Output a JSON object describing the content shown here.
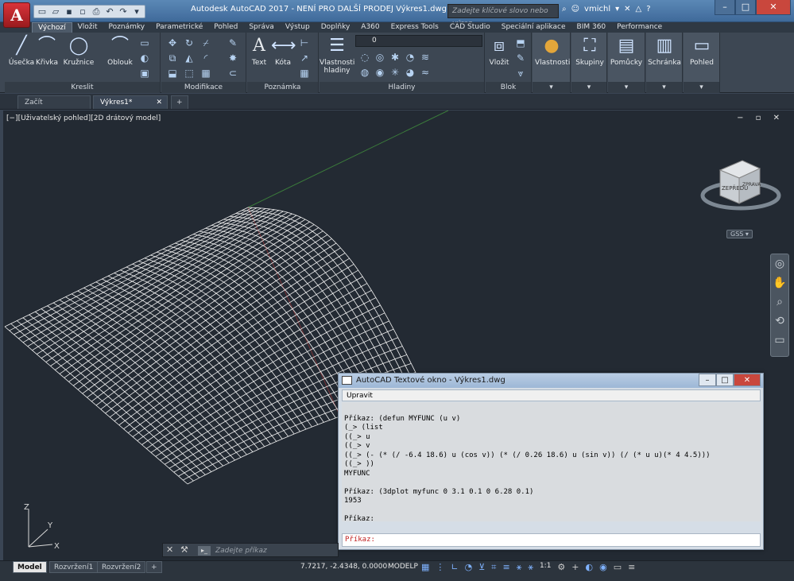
{
  "titlebar": {
    "app_letter": "A",
    "title": "Autodesk AutoCAD 2017 - NENÍ PRO DALŠÍ PRODEJ    Výkres1.dwg",
    "search_placeholder": "Zadejte klíčové slovo nebo výraz.",
    "user": "vmichl",
    "min": "–",
    "max": "□",
    "close": "✕"
  },
  "ribbon": {
    "tabs": [
      "Výchozí",
      "Vložit",
      "Poznámky",
      "Parametrické",
      "Pohled",
      "Správa",
      "Výstup",
      "Doplňky",
      "A360",
      "Express Tools",
      "CAD Studio",
      "Speciální aplikace",
      "BIM 360",
      "Performance"
    ],
    "draw": {
      "tools": [
        "Úsečka",
        "Křivka",
        "Kružnice",
        "Oblouk"
      ],
      "footer": "Kreslit"
    },
    "modify": {
      "footer": "Modifikace"
    },
    "annotation": {
      "tools": [
        "Text",
        "Kóta"
      ],
      "footer": "Poznámka"
    },
    "layers": {
      "layer_props": "Vlastnosti hladiny",
      "current_layer": "0",
      "footer": "Hladiny"
    },
    "block": {
      "insert": "Vložit",
      "footer": "Blok"
    },
    "extra": [
      "Vlastnosti",
      "Skupiny",
      "Pomůcky",
      "Schránka",
      "Pohled"
    ]
  },
  "doctabs": {
    "start": "Začít",
    "drawing": "Výkres1*",
    "plus": "+"
  },
  "viewport": {
    "label": "[−][Uživatelský pohled][2D drátový model]",
    "controls": "− ▫ ✕",
    "viewcube_face": "ZEPŘEDU",
    "viewcube_side": "ZPRAVA",
    "gss": "GSS"
  },
  "textwindow": {
    "title": "AutoCAD Textové okno - Výkres1.dwg",
    "menu": "Upravit",
    "lines": [
      "",
      "Příkaz: (defun MYFUNC (u v)",
      "(_> (list",
      "((_> u",
      "((_> v",
      "((_> (- (* (/ -6.4 18.6) u (cos v)) (* (/ 0.26 18.6) u (sin v)) (/ (* u u)(* 4 4.5)))",
      "((_> ))",
      "MYFUNC",
      "",
      "Příkaz: (3dplot myfunc 0 3.1 0.1 0 6.28 0.1)",
      "1953",
      "",
      "Příkaz:",
      "Příkaz:"
    ],
    "input": "Příkaz: "
  },
  "cmdline": {
    "placeholder": "Zadejte příkaz"
  },
  "statusbar": {
    "layouts": [
      "Model",
      "Rozvržení1",
      "Rozvržení2",
      "+"
    ],
    "coords": "7.7217, -2.4348, 0.0000",
    "space": "MODELP",
    "scale": "1:1"
  }
}
